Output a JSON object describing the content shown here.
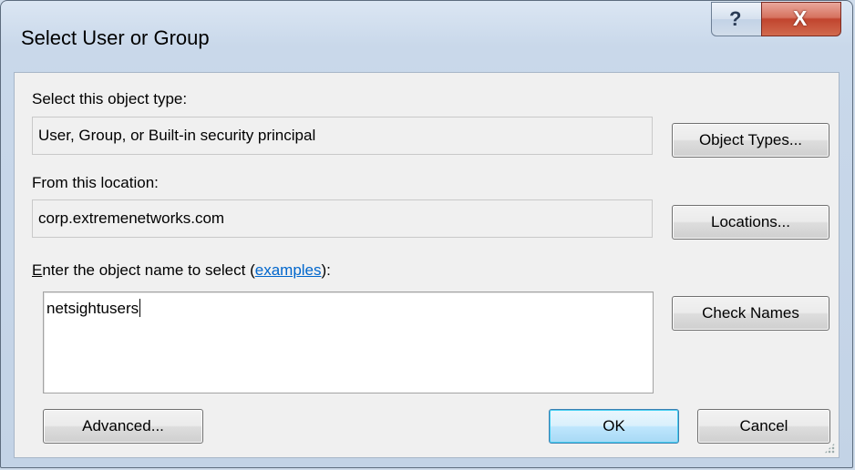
{
  "window": {
    "title": "Select User or Group"
  },
  "titlebar": {
    "help_glyph": "?",
    "close_glyph": "X"
  },
  "object_type": {
    "label": "Select this object type:",
    "value": "User, Group, or Built-in security principal",
    "button": "Object Types..."
  },
  "location": {
    "label": "From this location:",
    "value": "corp.extremenetworks.com",
    "button": "Locations..."
  },
  "object_name": {
    "label_prefix": "E",
    "label_main": "nter the object name to select (",
    "label_link": "examples",
    "label_suffix": "):",
    "value": "netsightusers",
    "check_button": "Check Names"
  },
  "footer": {
    "advanced_button": "Advanced...",
    "ok_button": "OK",
    "cancel_button": "Cancel"
  },
  "colors": {
    "link": "#0066cc",
    "close_red": "#c1442e",
    "default_button_border": "#3c7fb1"
  }
}
